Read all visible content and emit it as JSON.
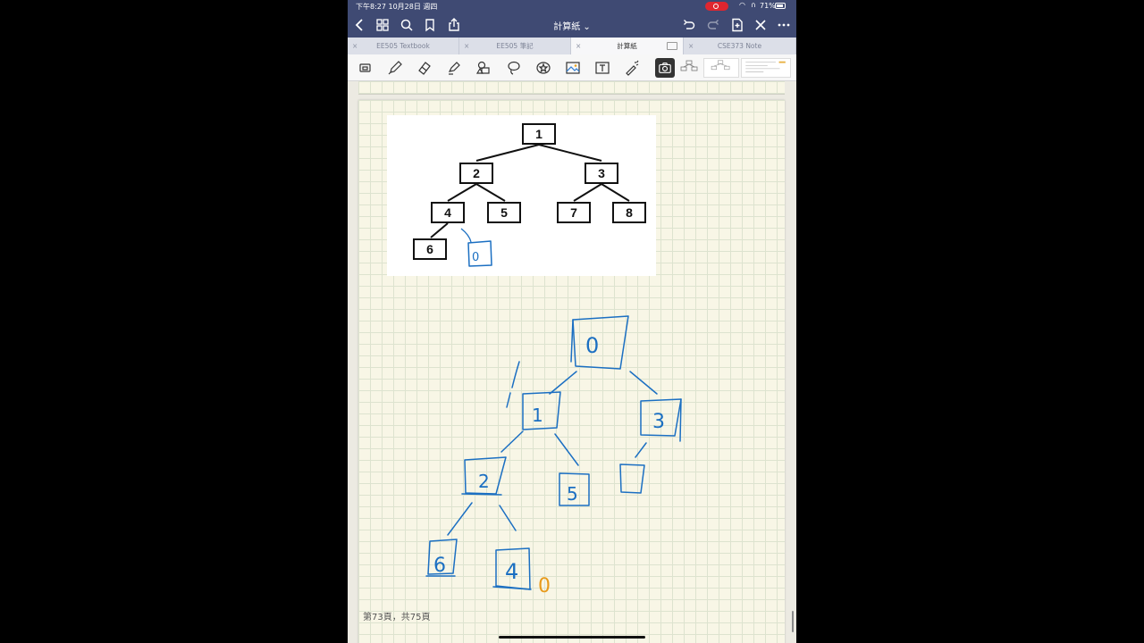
{
  "status": {
    "time_date": "下午8:27  10月28日 週四",
    "battery": "71%"
  },
  "nav": {
    "title": "計算紙 ⌄"
  },
  "tabs": [
    {
      "label": "EE505 Textbook",
      "active": false
    },
    {
      "label": "EE505 筆記",
      "active": false
    },
    {
      "label": "計算紙",
      "active": true
    },
    {
      "label": "CSE373 Note",
      "active": false
    }
  ],
  "tree": {
    "nodes": [
      "1",
      "2",
      "3",
      "4",
      "5",
      "7",
      "8",
      "6"
    ],
    "handwritten_added": "0",
    "handwritten_tree": [
      "0",
      "1",
      "3",
      "2",
      "5",
      "6",
      "4"
    ],
    "orange_note": "0"
  },
  "page_indicator": "第73頁，共75頁",
  "colors": {
    "nav_bar": "#3f4a73",
    "ink_blue": "#1b6fc2",
    "ink_orange": "#e89a1b",
    "paper": "#f8f6e6",
    "grid": "#dde3cf"
  }
}
